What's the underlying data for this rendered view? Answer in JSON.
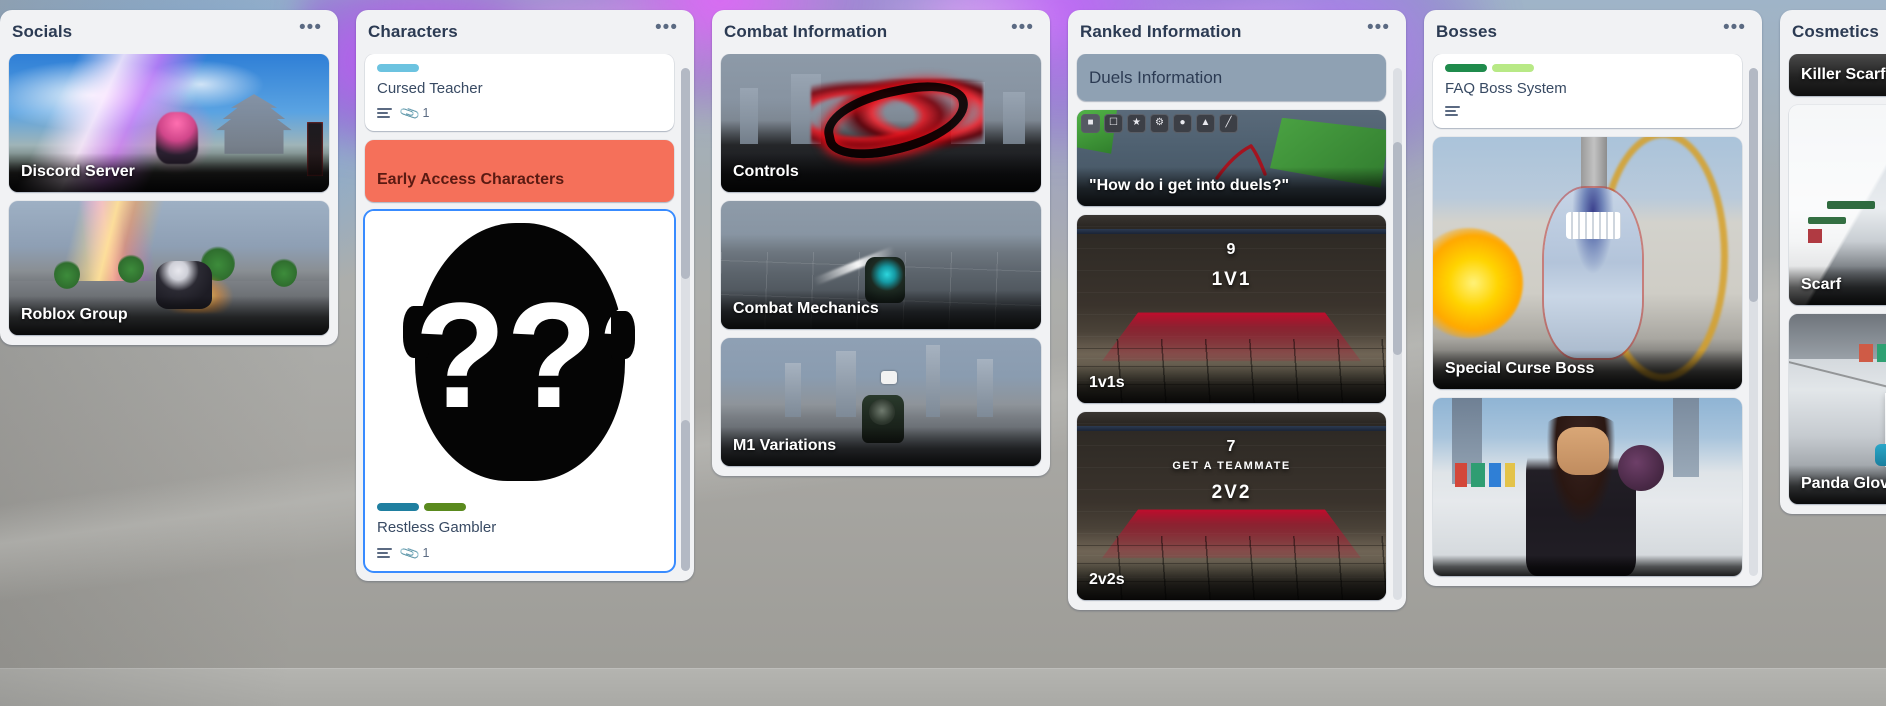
{
  "board": {
    "lists": [
      {
        "id": "socials",
        "title": "Socials",
        "menu_label": "•••",
        "cards": [
          {
            "id": "discord-server",
            "type": "cover",
            "title": "Discord Server"
          },
          {
            "id": "roblox-group",
            "type": "cover",
            "title": "Roblox Group"
          }
        ]
      },
      {
        "id": "characters",
        "title": "Characters",
        "menu_label": "•••",
        "cards": [
          {
            "id": "cursed-teacher",
            "type": "text",
            "title": "Cursed Teacher",
            "labels": [
              "#6cc3e0"
            ],
            "badge_attachments": "1",
            "has_description": true
          },
          {
            "id": "early-access-characters",
            "type": "color-cover",
            "title": "Early Access Characters",
            "cover_color": "#f5705a",
            "text_color": "#5a1a12"
          },
          {
            "id": "restless-gambler",
            "type": "image-card",
            "title": "Restless Gambler",
            "labels": [
              "#1f7fa0",
              "#5a8a1e"
            ],
            "badge_attachments": "1",
            "has_description": true,
            "selected": true,
            "cover_alt": "???"
          }
        ]
      },
      {
        "id": "combat-information",
        "title": "Combat Information",
        "menu_label": "•••",
        "cards": [
          {
            "id": "controls",
            "type": "cover",
            "title": "Controls"
          },
          {
            "id": "combat-mechanics",
            "type": "cover",
            "title": "Combat Mechanics"
          },
          {
            "id": "m1-variations",
            "type": "cover",
            "title": "M1 Variations"
          }
        ]
      },
      {
        "id": "ranked-information",
        "title": "Ranked Information",
        "menu_label": "•••",
        "cards": [
          {
            "id": "duels-information",
            "type": "grey-cover",
            "title": "Duels Information"
          },
          {
            "id": "how-do-i-get-into-duels",
            "type": "cover",
            "title": "\"How do i get into duels?\"",
            "icon_strip": [
              "roblox-icon",
              "screenshot-icon",
              "emote-icon",
              "settings-icon",
              "person-icon",
              "record-icon",
              "draw-icon"
            ]
          },
          {
            "id": "1v1s",
            "type": "cover-arena",
            "title": "1v1s",
            "arena_number": "9",
            "arena_sub": "",
            "arena_mode": "1V1"
          },
          {
            "id": "2v2s",
            "type": "cover-arena",
            "title": "2v2s",
            "arena_number": "7",
            "arena_sub": "GET A TEAMMATE",
            "arena_mode": "2V2"
          }
        ]
      },
      {
        "id": "bosses",
        "title": "Bosses",
        "menu_label": "•••",
        "cards": [
          {
            "id": "faq-boss-system",
            "type": "text",
            "title": "FAQ Boss System",
            "labels": [
              "#1f8b4c",
              "#b8e986"
            ],
            "has_description": true
          },
          {
            "id": "special-curse-boss",
            "type": "cover",
            "title": "Special Curse Boss"
          },
          {
            "id": "boss-2",
            "type": "cover",
            "title": ""
          }
        ]
      },
      {
        "id": "cosmetics",
        "title": "Cosmetics",
        "menu_label": "•••",
        "cards": [
          {
            "id": "killer-scarf",
            "type": "solid-cover",
            "title": "Killer Scarf"
          },
          {
            "id": "scarf",
            "type": "cover",
            "title": "Scarf"
          },
          {
            "id": "panda-glove",
            "type": "cover",
            "title": "Panda Glove"
          }
        ]
      }
    ]
  },
  "theme": {
    "list_background": "#f1f2f4",
    "card_background": "#ffffff",
    "title_color": "#2c3b53",
    "card_text_color": "#384a63",
    "selection_color": "#388bff",
    "scrollbar_track": "#dcdfe4",
    "scrollbar_thumb": "#b3b9c4"
  }
}
